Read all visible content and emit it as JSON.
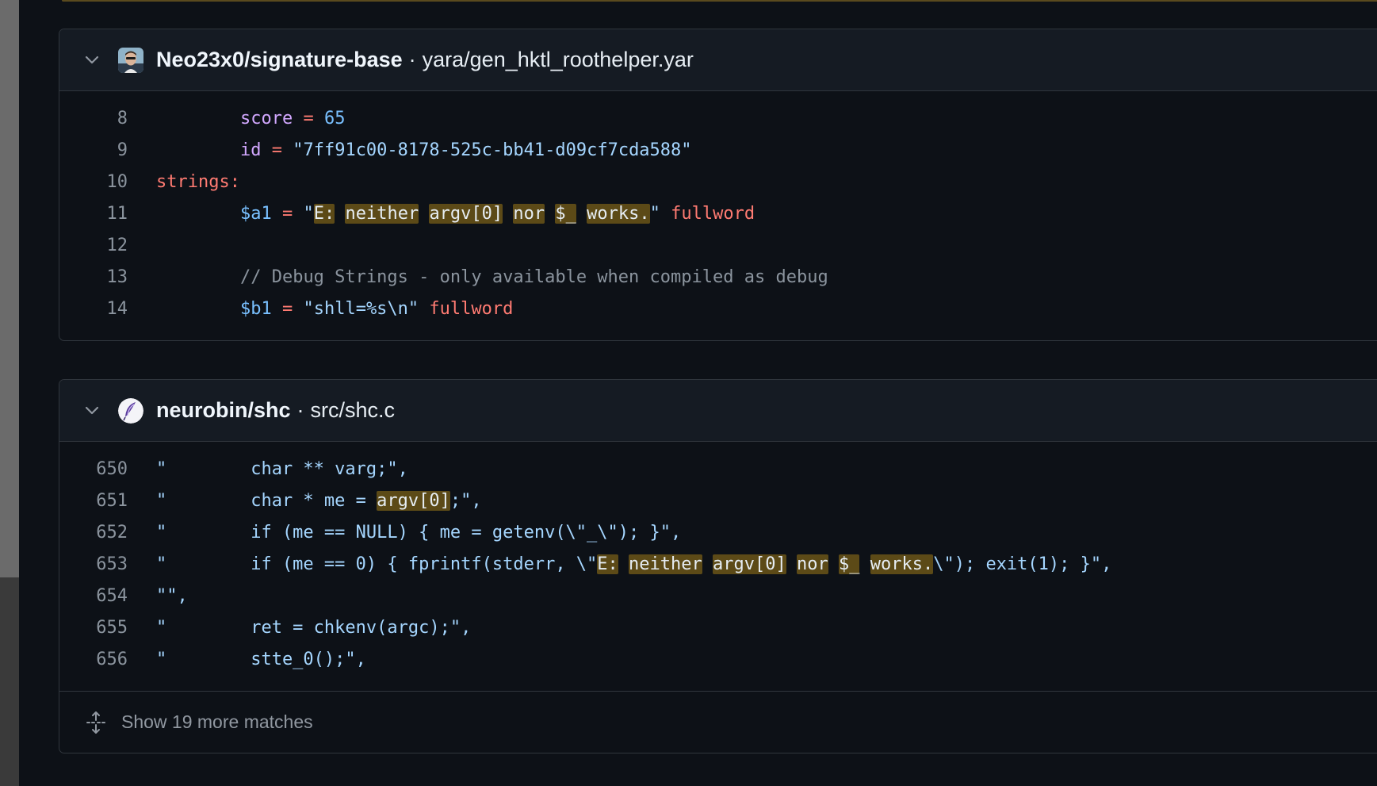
{
  "results": [
    {
      "repo": "Neo23x0/signature-base",
      "separator": "·",
      "path": "yara/gen_hktl_roothelper.yar",
      "avatar_icon": "user-avatar",
      "lines": [
        {
          "num": "8"
        },
        {
          "num": "9"
        },
        {
          "num": "10"
        },
        {
          "num": "11"
        },
        {
          "num": "12"
        },
        {
          "num": "13"
        },
        {
          "num": "14"
        }
      ],
      "code": {
        "l8_key": "score",
        "l8_eq": " = ",
        "l8_val": "65",
        "l9_key": "id",
        "l9_eq": " = ",
        "l9_val": "\"7ff91c00-8178-525c-bb41-d09cf7cda588\"",
        "l10": "strings:",
        "l11_var": "$a1",
        "l11_eq": " = ",
        "l11_q1": "\"",
        "l11_m1": "E:",
        "l11_m2": "neither",
        "l11_m3": "argv[0]",
        "l11_m4": "nor",
        "l11_m5": "$_",
        "l11_m6": "works.",
        "l11_q2": "\"",
        "l11_mod": "fullword",
        "l13": "// Debug Strings - only available when compiled as debug",
        "l14_var": "$b1",
        "l14_eq": " = ",
        "l14_val": "\"shll=%s\\n\"",
        "l14_mod": "fullword"
      }
    },
    {
      "repo": "neurobin/shc",
      "separator": "·",
      "path": "src/shc.c",
      "avatar_icon": "feather-avatar",
      "lines": [
        {
          "num": "650"
        },
        {
          "num": "651"
        },
        {
          "num": "652"
        },
        {
          "num": "653"
        },
        {
          "num": "654"
        },
        {
          "num": "655"
        },
        {
          "num": "656"
        }
      ],
      "code": {
        "l650": "\"        char ** varg;\",",
        "l651_a": "\"        char * me = ",
        "l651_m": "argv[0]",
        "l651_b": ";\",",
        "l652": "\"        if (me == NULL) { me = getenv(\\\"_\\\"); }\",",
        "l653_a": "\"        if (me == 0) { fprintf(stderr, \\\"",
        "l653_m1": "E:",
        "l653_m2": "neither",
        "l653_m3": "argv[0]",
        "l653_m4": "nor",
        "l653_m5": "$_",
        "l653_m6": "works.",
        "l653_b": "\\\"); exit(1); }\",",
        "l654": "\"\",",
        "l655": "\"        ret = chkenv(argc);\",",
        "l656": "\"        stte_0();\","
      },
      "footer": "Show 19 more matches"
    }
  ],
  "colors": {
    "background": "#0d1117",
    "header": "#151b23",
    "border": "#30363d",
    "match_highlight": "#5c4a17",
    "keyword_red": "#ff7b72",
    "keyword_purple": "#d2a8ff",
    "constant_blue": "#79c0ff",
    "string_blue": "#a5d6ff"
  },
  "icons": {
    "collapse": "chevron-down-icon",
    "expand_more": "unfold-icon"
  }
}
